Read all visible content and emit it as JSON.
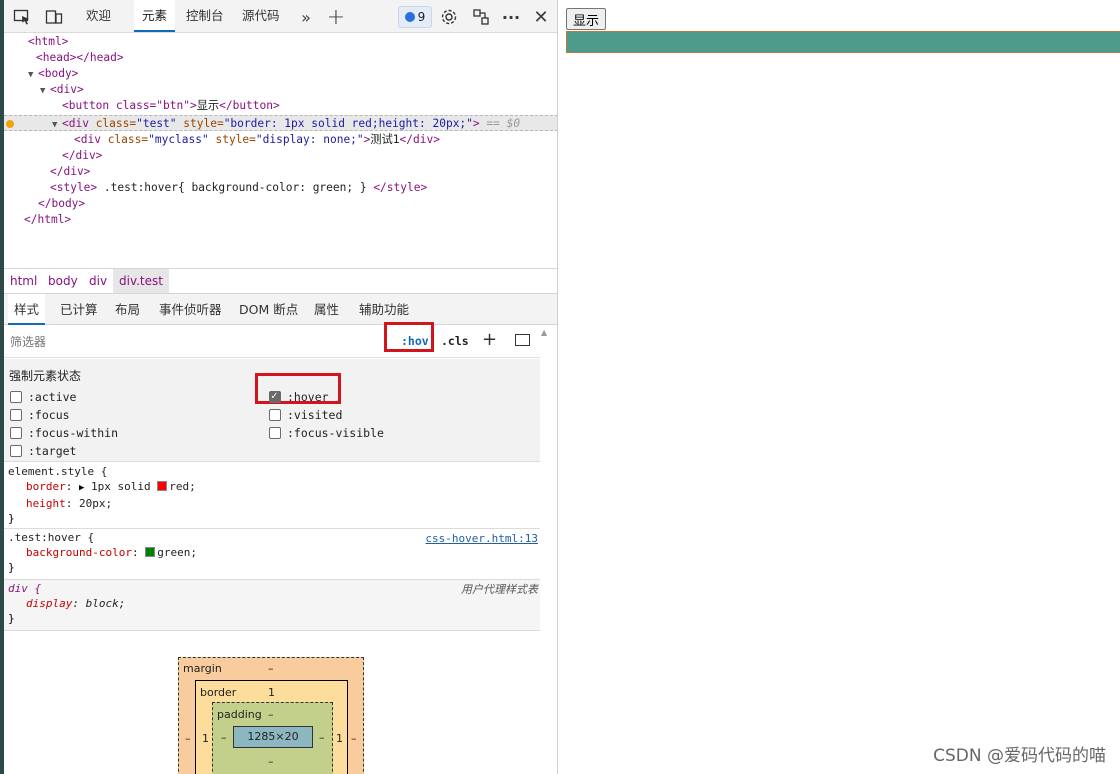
{
  "toolbar": {
    "tabs": [
      "欢迎",
      "元素",
      "控制台",
      "源代码"
    ],
    "active_tab": "元素",
    "issue_count": "9",
    "more_tabs_icon": "chevrons-right-icon",
    "add_tab_icon": "plus-icon"
  },
  "dom": {
    "line_html_open": "<html>",
    "line_head": "<head></head>",
    "line_body_open": "<body>",
    "line_div_open": "<div>",
    "btn_open": "<button class=\"btn\">",
    "btn_text": "显示",
    "btn_close": "</button>",
    "sel_tag_open": "<div",
    "sel_attr1": " class=",
    "sel_val1": "\"test\"",
    "sel_attr2": " style=",
    "sel_val2": "\"border: 1px solid red;height: 20px;\"",
    "sel_tag_close": ">",
    "sel_eq": " == $0",
    "myclass_open": "<div",
    "myclass_attr1": " class=",
    "myclass_val1": "\"myclass\"",
    "myclass_attr2": " style=",
    "myclass_val2": "\"display: none;\"",
    "myclass_gt": ">",
    "myclass_text": "测试1",
    "myclass_close": "</div>",
    "inner_div_close": "</div>",
    "outer_div_close": "</div>",
    "style_open": "<style>",
    "style_text": " .test:hover{ background-color: green; } ",
    "style_close": "</style>",
    "body_close": "</body>",
    "html_close": "</html>"
  },
  "breadcrumb": [
    "html",
    "body",
    "div",
    "div.test"
  ],
  "subtabs": [
    "样式",
    "已计算",
    "布局",
    "事件侦听器",
    "DOM 断点",
    "属性",
    "辅助功能"
  ],
  "filter": {
    "placeholder": "筛选器",
    "hov": ":hov",
    ".cls": ".cls"
  },
  "force_state": {
    "title": "强制元素状态",
    "left": [
      ":active",
      ":focus",
      ":focus-within",
      ":target"
    ],
    "right": [
      ":hover",
      ":visited",
      ":focus-visible"
    ],
    "checked": [
      ":hover"
    ]
  },
  "rules": {
    "element_style": {
      "selector": "element.style {",
      "border_prop": "border",
      "border_val_pre": "1px solid",
      "border_val_color": "red",
      "border_color_hex": "#ff0000",
      "height_prop": "height",
      "height_val": "20px",
      "close": "}"
    },
    "test_hover": {
      "selector": ".test:hover {",
      "source": "css-hover.html:13",
      "prop": "background-color",
      "val": "green",
      "color_hex": "#008000",
      "close": "}"
    },
    "div_ua": {
      "selector": "div {",
      "source": "用户代理样式表",
      "prop": "display",
      "val": "block",
      "close": "}"
    }
  },
  "box_model": {
    "margin_label": "margin",
    "margin_top": "–",
    "margin_left": "–",
    "margin_right": "–",
    "border_label": "border",
    "border_top": "1",
    "border_left": "1",
    "border_right": "1",
    "padding_label": "padding",
    "padding_top": "–",
    "padding_left": "–",
    "padding_right": "–",
    "padding_bottom": "–",
    "content": "1285×20"
  },
  "page": {
    "button_label": "显示",
    "test_div_bg": "#4c9b8b",
    "watermark": "CSDN @爱码代码的喵"
  }
}
